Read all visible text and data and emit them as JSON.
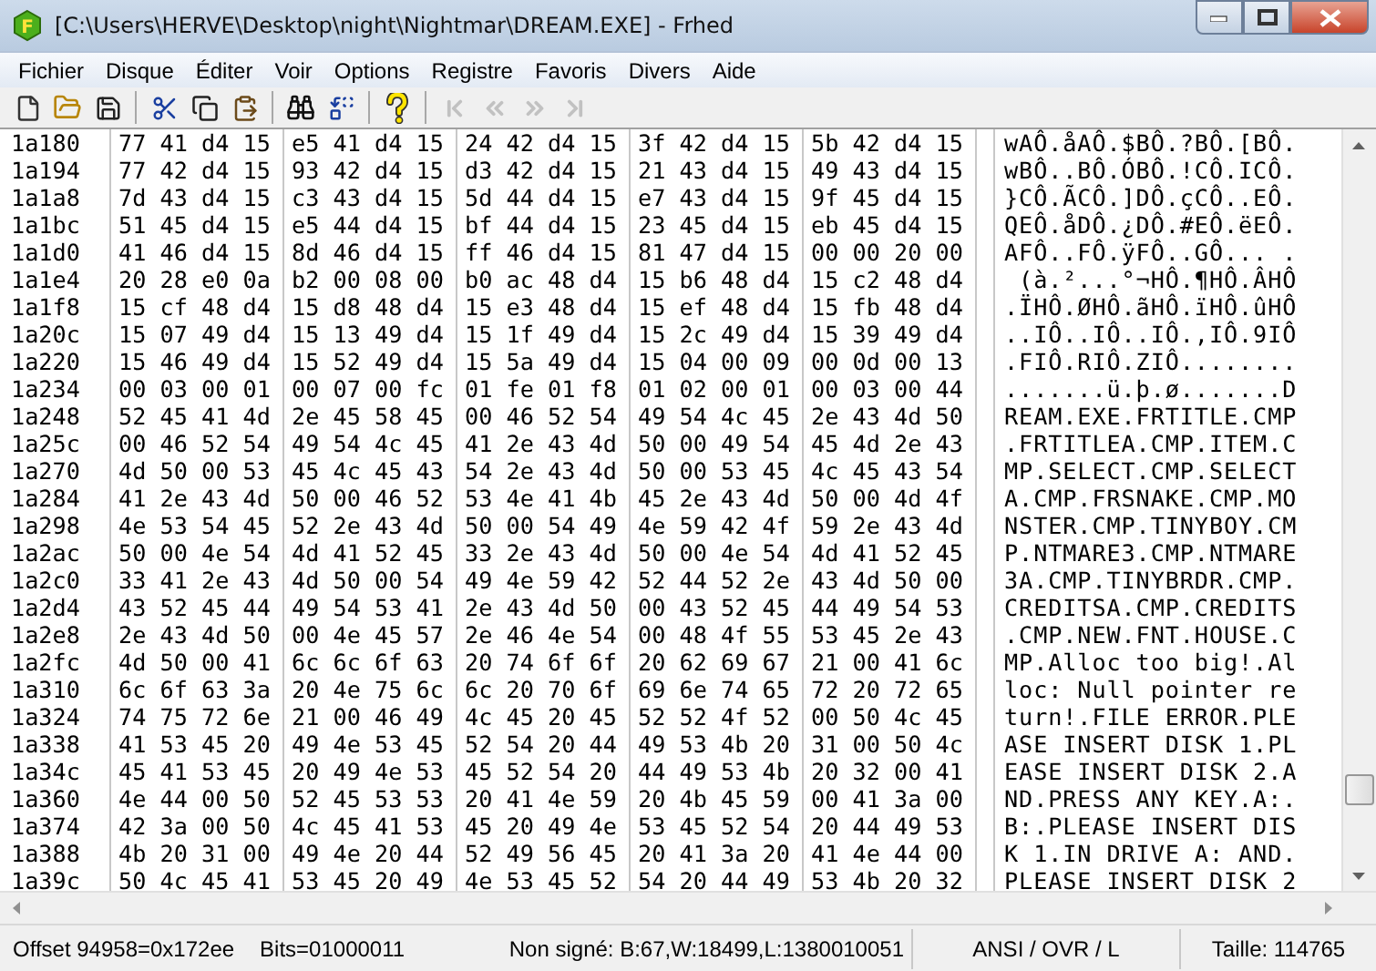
{
  "window": {
    "title": "[C:\\Users\\HERVE\\Desktop\\night\\Nightmar\\DREAM.EXE] - Frhed",
    "logo": "F"
  },
  "menu": [
    "Fichier",
    "Disque",
    "Éditer",
    "Voir",
    "Options",
    "Registre",
    "Favoris",
    "Divers",
    "Aide"
  ],
  "toolbar": {
    "nav_buttons": [
      {
        "disabled": true
      },
      {
        "disabled": true
      },
      {
        "disabled": true
      },
      {
        "disabled": true
      }
    ]
  },
  "rows": [
    {
      "offset": "1a180",
      "hex": [
        "77 41 d4 15",
        "e5 41 d4 15",
        "24 42 d4 15",
        "3f 42 d4 15",
        "5b 42 d4 15"
      ],
      "ascii": "wAÔ.åAÔ.$BÔ.?BÔ.[BÔ."
    },
    {
      "offset": "1a194",
      "hex": [
        "77 42 d4 15",
        "93 42 d4 15",
        "d3 42 d4 15",
        "21 43 d4 15",
        "49 43 d4 15"
      ],
      "ascii": "wBÔ..BÔ.ÓBÔ.!CÔ.ICÔ."
    },
    {
      "offset": "1a1a8",
      "hex": [
        "7d 43 d4 15",
        "c3 43 d4 15",
        "5d 44 d4 15",
        "e7 43 d4 15",
        "9f 45 d4 15"
      ],
      "ascii": "}CÔ.ÃCÔ.]DÔ.çCÔ..EÔ."
    },
    {
      "offset": "1a1bc",
      "hex": [
        "51 45 d4 15",
        "e5 44 d4 15",
        "bf 44 d4 15",
        "23 45 d4 15",
        "eb 45 d4 15"
      ],
      "ascii": "QEÔ.åDÔ.¿DÔ.#EÔ.ëEÔ."
    },
    {
      "offset": "1a1d0",
      "hex": [
        "41 46 d4 15",
        "8d 46 d4 15",
        "ff 46 d4 15",
        "81 47 d4 15",
        "00 00 20 00"
      ],
      "ascii": "AFÔ..FÔ.ÿFÔ..GÔ... ."
    },
    {
      "offset": "1a1e4",
      "hex": [
        "20 28 e0 0a",
        "b2 00 08 00",
        "b0 ac 48 d4",
        "15 b6 48 d4",
        "15 c2 48 d4"
      ],
      "ascii": " (à.²...°¬HÔ.¶HÔ.ÂHÔ"
    },
    {
      "offset": "1a1f8",
      "hex": [
        "15 cf 48 d4",
        "15 d8 48 d4",
        "15 e3 48 d4",
        "15 ef 48 d4",
        "15 fb 48 d4"
      ],
      "ascii": ".ÏHÔ.ØHÔ.ãHÔ.ïHÔ.ûHÔ"
    },
    {
      "offset": "1a20c",
      "hex": [
        "15 07 49 d4",
        "15 13 49 d4",
        "15 1f 49 d4",
        "15 2c 49 d4",
        "15 39 49 d4"
      ],
      "ascii": "..IÔ..IÔ..IÔ.,IÔ.9IÔ"
    },
    {
      "offset": "1a220",
      "hex": [
        "15 46 49 d4",
        "15 52 49 d4",
        "15 5a 49 d4",
        "15 04 00 09",
        "00 0d 00 13"
      ],
      "ascii": ".FIÔ.RIÔ.ZIÔ........"
    },
    {
      "offset": "1a234",
      "hex": [
        "00 03 00 01",
        "00 07 00 fc",
        "01 fe 01 f8",
        "01 02 00 01",
        "00 03 00 44"
      ],
      "ascii": ".......ü.þ.ø.......D"
    },
    {
      "offset": "1a248",
      "hex": [
        "52 45 41 4d",
        "2e 45 58 45",
        "00 46 52 54",
        "49 54 4c 45",
        "2e 43 4d 50"
      ],
      "ascii": "REAM.EXE.FRTITLE.CMP"
    },
    {
      "offset": "1a25c",
      "hex": [
        "00 46 52 54",
        "49 54 4c 45",
        "41 2e 43 4d",
        "50 00 49 54",
        "45 4d 2e 43"
      ],
      "ascii": ".FRTITLEA.CMP.ITEM.C"
    },
    {
      "offset": "1a270",
      "hex": [
        "4d 50 00 53",
        "45 4c 45 43",
        "54 2e 43 4d",
        "50 00 53 45",
        "4c 45 43 54"
      ],
      "ascii": "MP.SELECT.CMP.SELECT"
    },
    {
      "offset": "1a284",
      "hex": [
        "41 2e 43 4d",
        "50 00 46 52",
        "53 4e 41 4b",
        "45 2e 43 4d",
        "50 00 4d 4f"
      ],
      "ascii": "A.CMP.FRSNAKE.CMP.MO"
    },
    {
      "offset": "1a298",
      "hex": [
        "4e 53 54 45",
        "52 2e 43 4d",
        "50 00 54 49",
        "4e 59 42 4f",
        "59 2e 43 4d"
      ],
      "ascii": "NSTER.CMP.TINYBOY.CM"
    },
    {
      "offset": "1a2ac",
      "hex": [
        "50 00 4e 54",
        "4d 41 52 45",
        "33 2e 43 4d",
        "50 00 4e 54",
        "4d 41 52 45"
      ],
      "ascii": "P.NTMARE3.CMP.NTMARE"
    },
    {
      "offset": "1a2c0",
      "hex": [
        "33 41 2e 43",
        "4d 50 00 54",
        "49 4e 59 42",
        "52 44 52 2e",
        "43 4d 50 00"
      ],
      "ascii": "3A.CMP.TINYBRDR.CMP."
    },
    {
      "offset": "1a2d4",
      "hex": [
        "43 52 45 44",
        "49 54 53 41",
        "2e 43 4d 50",
        "00 43 52 45",
        "44 49 54 53"
      ],
      "ascii": "CREDITSA.CMP.CREDITS"
    },
    {
      "offset": "1a2e8",
      "hex": [
        "2e 43 4d 50",
        "00 4e 45 57",
        "2e 46 4e 54",
        "00 48 4f 55",
        "53 45 2e 43"
      ],
      "ascii": ".CMP.NEW.FNT.HOUSE.C"
    },
    {
      "offset": "1a2fc",
      "hex": [
        "4d 50 00 41",
        "6c 6c 6f 63",
        "20 74 6f 6f",
        "20 62 69 67",
        "21 00 41 6c"
      ],
      "ascii": "MP.Alloc too big!.Al"
    },
    {
      "offset": "1a310",
      "hex": [
        "6c 6f 63 3a",
        "20 4e 75 6c",
        "6c 20 70 6f",
        "69 6e 74 65",
        "72 20 72 65"
      ],
      "ascii": "loc: Null pointer re"
    },
    {
      "offset": "1a324",
      "hex": [
        "74 75 72 6e",
        "21 00 46 49",
        "4c 45 20 45",
        "52 52 4f 52",
        "00 50 4c 45"
      ],
      "ascii": "turn!.FILE ERROR.PLE"
    },
    {
      "offset": "1a338",
      "hex": [
        "41 53 45 20",
        "49 4e 53 45",
        "52 54 20 44",
        "49 53 4b 20",
        "31 00 50 4c"
      ],
      "ascii": "ASE INSERT DISK 1.PL"
    },
    {
      "offset": "1a34c",
      "hex": [
        "45 41 53 45",
        "20 49 4e 53",
        "45 52 54 20",
        "44 49 53 4b",
        "20 32 00 41"
      ],
      "ascii": "EASE INSERT DISK 2.A"
    },
    {
      "offset": "1a360",
      "hex": [
        "4e 44 00 50",
        "52 45 53 53",
        "20 41 4e 59",
        "20 4b 45 59",
        "00 41 3a 00"
      ],
      "ascii": "ND.PRESS ANY KEY.A:."
    },
    {
      "offset": "1a374",
      "hex": [
        "42 3a 00 50",
        "4c 45 41 53",
        "45 20 49 4e",
        "53 45 52 54",
        "20 44 49 53"
      ],
      "ascii": "B:.PLEASE INSERT DIS"
    },
    {
      "offset": "1a388",
      "hex": [
        "4b 20 31 00",
        "49 4e 20 44",
        "52 49 56 45",
        "20 41 3a 20",
        "41 4e 44 00"
      ],
      "ascii": "K 1.IN DRIVE A: AND."
    },
    {
      "offset": "1a39c",
      "hex": [
        "50 4c 45 41",
        "53 45 20 49",
        "4e 53 45 52",
        "54 20 44 49",
        "53 4b 20 32"
      ],
      "ascii": "PLEASE INSERT DISK 2"
    }
  ],
  "status_bar": [
    "Offset 94958=0x172ee",
    "Bits=01000011",
    "Non signé: B:67,W:18499,L:1380010051",
    "ANSI / OVR / L",
    "Taille: 114765"
  ]
}
